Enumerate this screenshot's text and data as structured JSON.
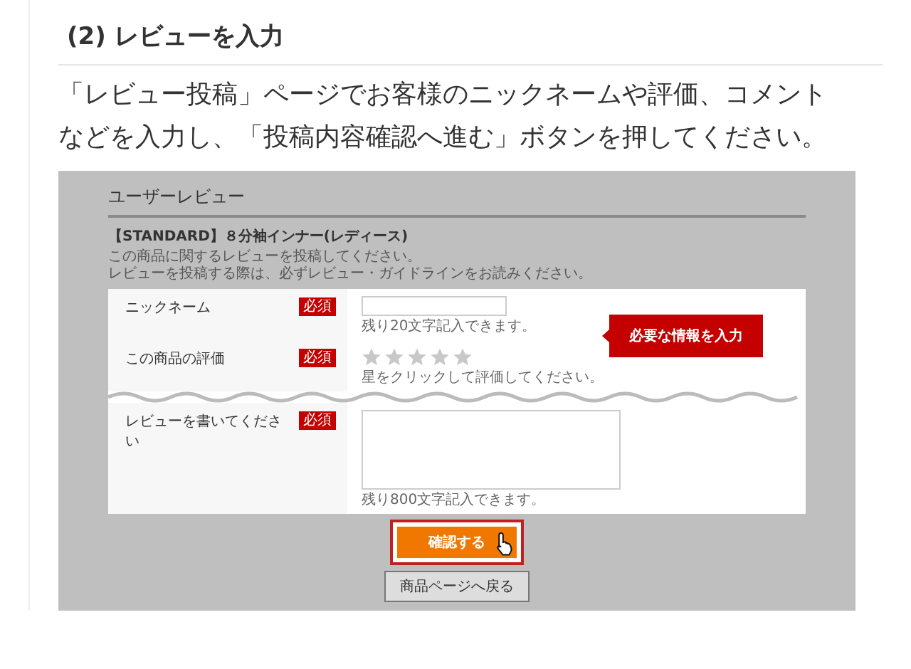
{
  "heading": "(2) レビューを入力",
  "instruction": "「レビュー投稿」ページでお客様のニックネームや評価、コメントなどを入力し、「投稿内容確認へ進む」ボタンを押してください。",
  "screenshot": {
    "title": "ユーザーレビュー",
    "product": "【STANDARD】８分袖インナー(レディース)",
    "notes": [
      "この商品に関するレビューを投稿してください。",
      "レビューを投稿する際は、必ずレビュー・ガイドラインをお読みください。"
    ],
    "fields": [
      {
        "kind": "text",
        "label": "ニックネーム",
        "badge": "必須",
        "hint": "残り20文字記入できます。"
      },
      {
        "kind": "rating",
        "label": "この商品の評価",
        "badge": "必須",
        "stars": 0,
        "hint": "星をクリックして評価してください。",
        "cut_below": true
      },
      {
        "kind": "textarea",
        "label": "レビューを書いてください",
        "badge": "必須",
        "hint": "残り800文字記入できます。"
      }
    ],
    "callout": "必要な情報を入力",
    "confirm_button": "確認する",
    "back_button": "商品ページへ戻る"
  }
}
